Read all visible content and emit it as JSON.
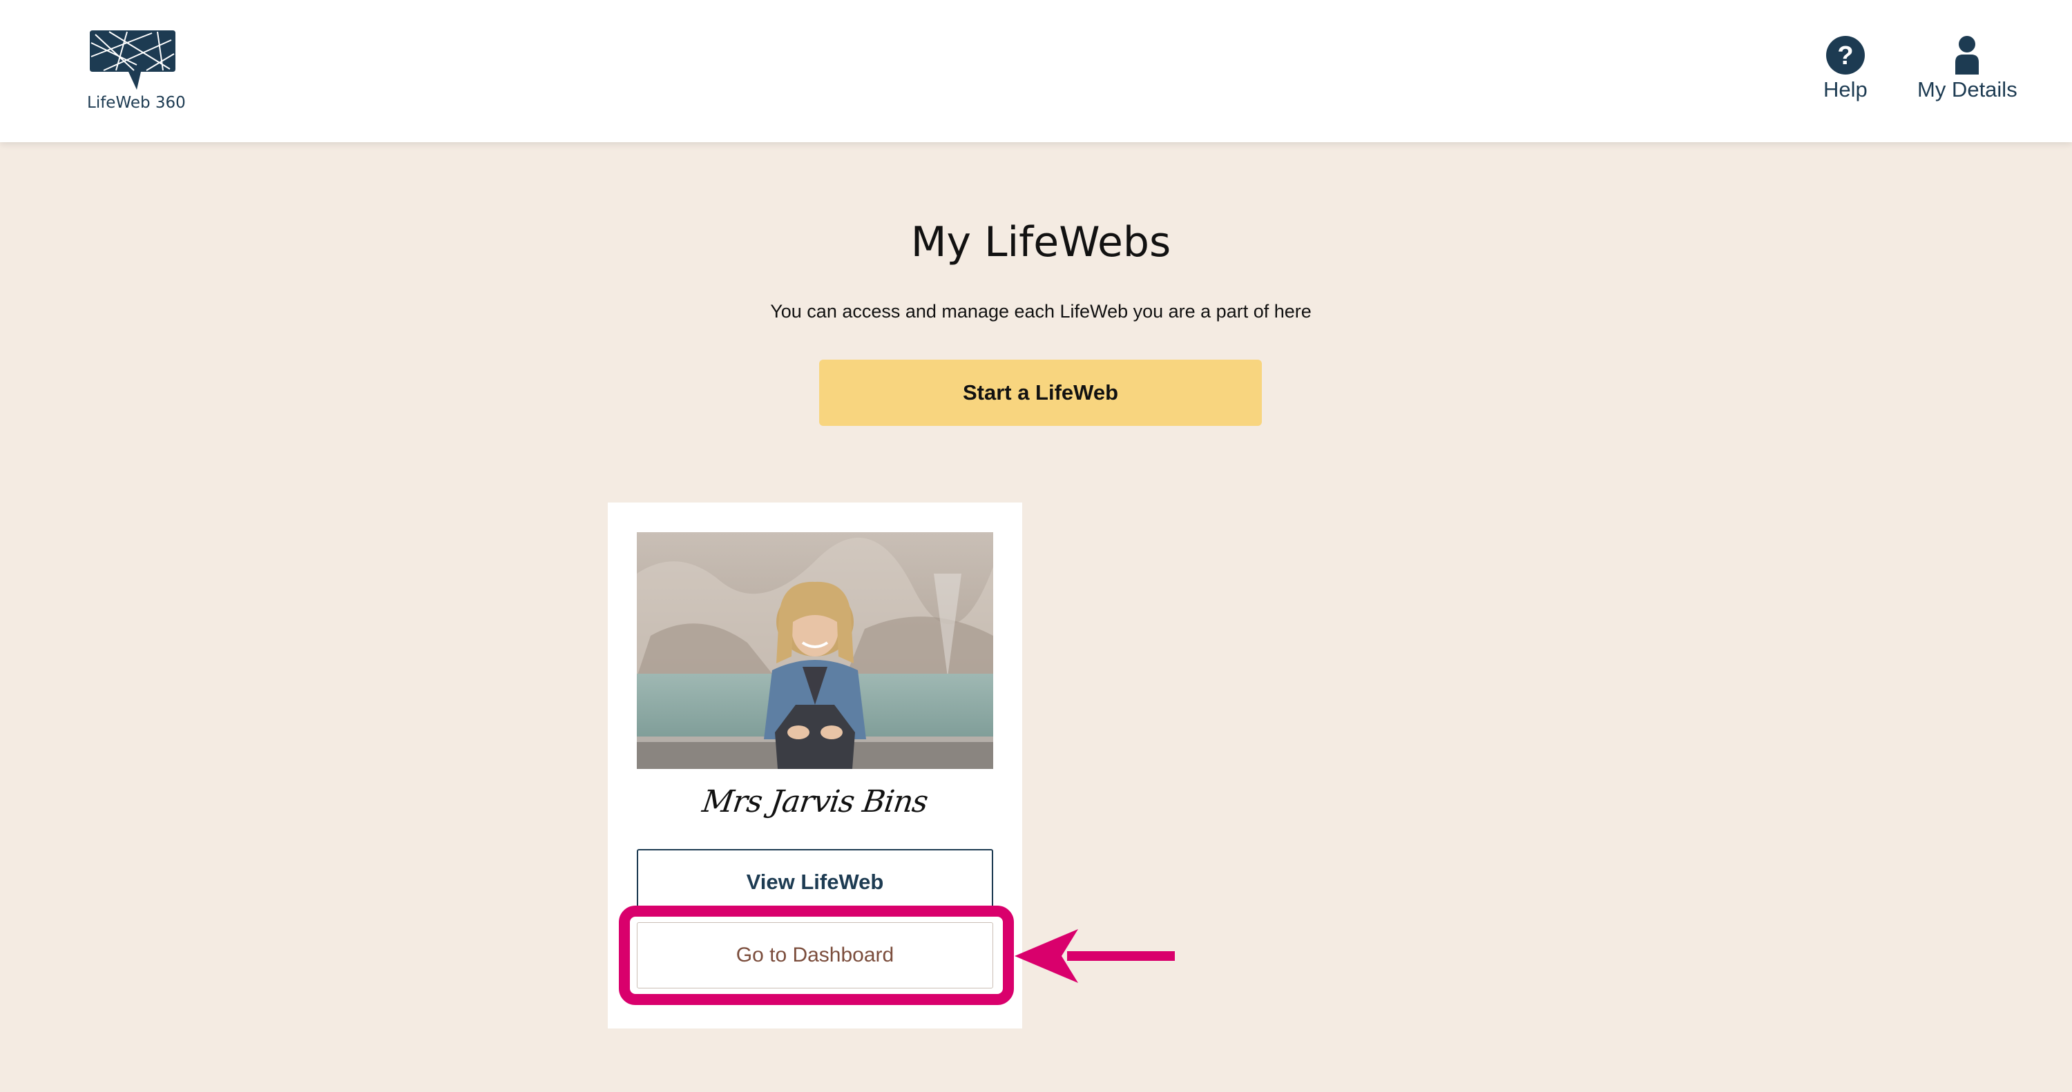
{
  "header": {
    "logo_text": "LifeWeb 360",
    "nav": {
      "help_label": "Help",
      "details_label": "My Details"
    }
  },
  "main": {
    "title": "My LifeWebs",
    "subtitle": "You can access and manage each LifeWeb you are a part of here",
    "start_button_label": "Start a LifeWeb"
  },
  "card": {
    "name": "Mrs Jarvis Bins",
    "view_button_label": "View LifeWeb",
    "dashboard_button_label": "Go to Dashboard"
  },
  "colors": {
    "brand_navy": "#1d3b52",
    "page_background": "#f4ebe2",
    "start_button": "#f8d57f",
    "dashboard_text": "#7b4d3c",
    "highlight": "#d9006c"
  },
  "icons": [
    "lifeweb-logo-icon",
    "help-icon",
    "user-icon",
    "arrow-left-icon"
  ]
}
